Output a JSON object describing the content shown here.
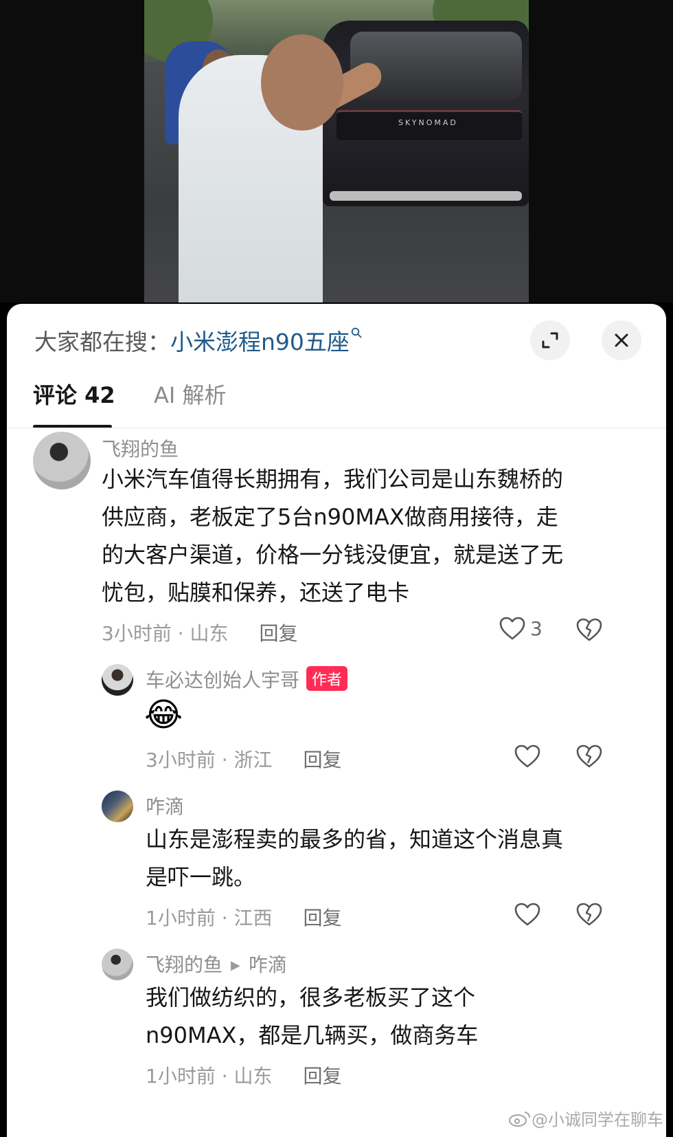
{
  "video": {
    "car_brand": "SKYNOMAD"
  },
  "search": {
    "prefix": "大家都在搜：",
    "term": "小米澎程n90五座"
  },
  "tabs": [
    {
      "label": "评论 42"
    },
    {
      "label": "AI 解析"
    }
  ],
  "comments": [
    {
      "user": "飞翔的鱼",
      "text_lines": [
        "小米汽车值得长期拥有，我们公司是山东魏桥的",
        "供应商，老板定了5台n90MAX做商用接待，走",
        "的大客户渠道，价格一分钱没便宜，就是送了无",
        "忧包，贴膜和保养，还送了电卡"
      ],
      "time": "3小时前",
      "location": "山东",
      "reply": "回复",
      "likes": "3"
    },
    {
      "user": "车必达创始人宇哥",
      "badge": "作者",
      "emoji": "😂",
      "time": "3小时前",
      "location": "浙江",
      "reply": "回复"
    },
    {
      "user": "咋滴",
      "text_lines": [
        "山东是澎程卖的最多的省，知道这个消息真",
        "是吓一跳。"
      ],
      "time": "1小时前",
      "location": "江西",
      "reply": "回复"
    },
    {
      "user": "飞翔的鱼",
      "reply_to": "咋滴",
      "text_lines": [
        "我们做纺织的，很多老板买了这个",
        "n90MAX，都是几辆买，做商务车"
      ],
      "time": "1小时前",
      "location": "山东",
      "reply": "回复"
    }
  ],
  "watermark": "@小诚同学在聊车",
  "colors": {
    "link": "#1f5a8a",
    "badge": "#ff2c55",
    "text": "#161616",
    "muted": "#9a9a9a"
  }
}
